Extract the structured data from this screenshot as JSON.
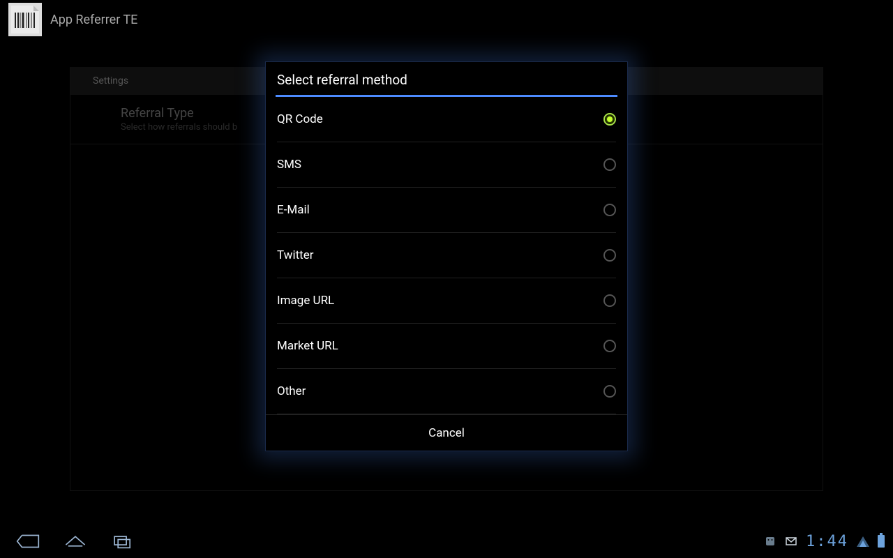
{
  "header": {
    "app_title": "App Referrer TE"
  },
  "settings": {
    "section_header": "Settings",
    "item_title": "Referral Type",
    "item_subtitle": "Select how referrals should b"
  },
  "dialog": {
    "title": "Select referral method",
    "options": [
      {
        "label": "QR Code",
        "selected": true
      },
      {
        "label": "SMS",
        "selected": false
      },
      {
        "label": "E-Mail",
        "selected": false
      },
      {
        "label": "Twitter",
        "selected": false
      },
      {
        "label": "Image URL",
        "selected": false
      },
      {
        "label": "Market URL",
        "selected": false
      },
      {
        "label": "Other",
        "selected": false
      }
    ],
    "cancel_label": "Cancel"
  },
  "navbar": {
    "clock": "1:44"
  }
}
